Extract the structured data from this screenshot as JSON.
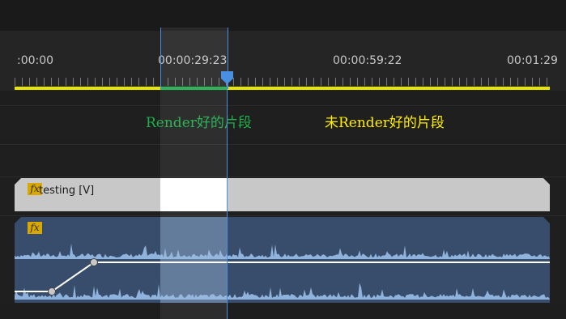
{
  "timeline": {
    "ruler": {
      "timecodes": [
        ":00:00",
        "00:00:29:23",
        "00:00:59:22",
        "00:01:29"
      ]
    },
    "annotations": {
      "rendered": "Render好的片段",
      "unrendered": "未Render好的片段"
    },
    "tracks": {
      "video_clip": {
        "fx": "fx",
        "name": "testing [V]"
      },
      "audio_clip": {
        "fx": "fx"
      }
    }
  },
  "colors": {
    "render_done": "#1eb04a",
    "render_needed": "#e6e600",
    "playhead": "#4a90e2",
    "fx_badge": "#d6a800"
  }
}
